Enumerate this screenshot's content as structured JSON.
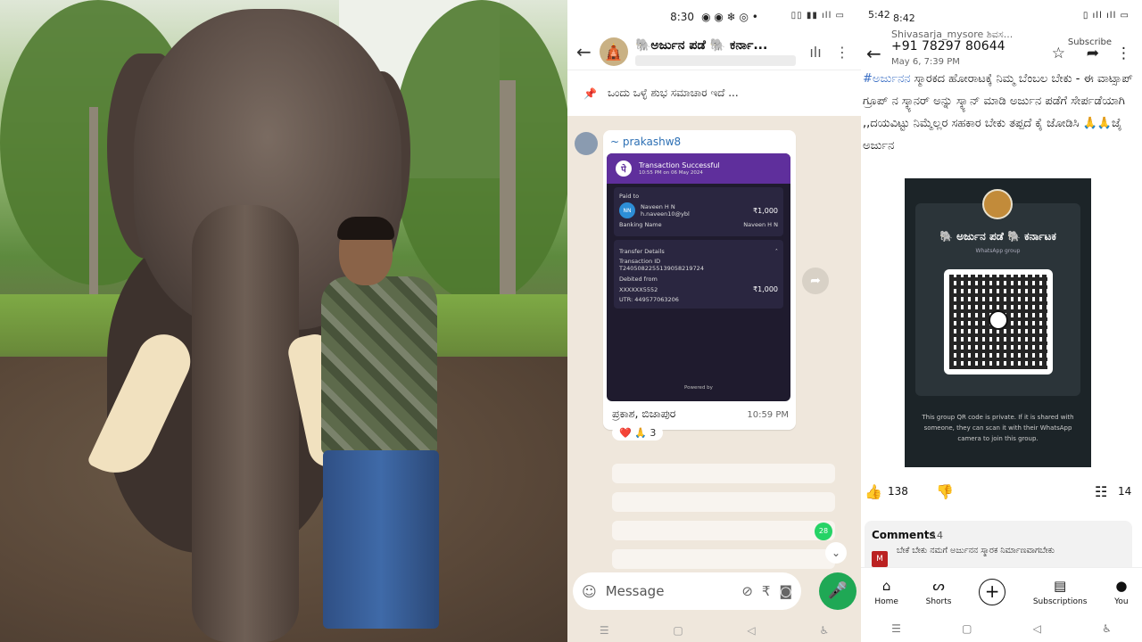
{
  "photo": {
    "description_icon": "elephant-photo"
  },
  "whatsapp": {
    "status_time": "8:30",
    "status_icons": "◉ ◉ ❄ ◎ •",
    "status_right": "▯▯ ▮▮ ıll ▭",
    "group_title": "🐘ಅರ್ಜುನ ಪಡೆ 🐘 ಕರ್ನಾ...",
    "pinned_text": "ಒಂದು ಒಳ್ಳೆ ಶುಭ ಸಮಾಚಾರ ಇದೆ ...",
    "sender": "~ prakashw8",
    "receipt": {
      "title": "Transaction Successful",
      "time": "10:55 PM on 06 May 2024",
      "paid_to_label": "Paid to",
      "initials": "NN",
      "payee": "Naveen H N",
      "upi": "h.naveen10@ybl",
      "amount": "₹1,000",
      "banking_label": "Banking Name",
      "banking_name": "Naveen H N",
      "transfer_label": "Transfer Details",
      "txn_label": "Transaction ID",
      "txn_id": "T2405082255139058219724",
      "debited_label": "Debited from",
      "account": "XXXXXX5552",
      "debit_amount": "₹1,000",
      "utr": "UTR: 449577063206",
      "powered": "Powered by"
    },
    "caption": "ಪ್ರಕಾಶ, ಬಿಜಾಪುರ",
    "time": "10:59 PM",
    "reactions": "❤️ 🙏 3",
    "unread_count": "28",
    "composer_placeholder": "Message"
  },
  "youtube": {
    "status_time": "5:42",
    "status_time2": "8:42",
    "status_right": "▯ ıll ıll ▭",
    "channel": "Shivasarja_mysore ಶಿವಸ...",
    "phone": "+91 78297 80644",
    "date": "May 6, 7:39 PM",
    "subscribe": "Subscribe",
    "post_hash": "#ಅರ್ಜುನನ",
    "post_text": " ಸ್ಮಾರಕದ ಹೋರಾಟಕ್ಕೆ ನಿಮ್ಮ ಬೆಂಬಲ ಬೇಕು - ಈ ವಾಟ್ಸಾಪ್ ಗ್ರೂಪ್ ನ ಸ್ಕ್ಯಾನರ್ ಅನ್ನು ಸ್ಕ್ಯಾನ್ ಮಾಡಿ ಅರ್ಜುನ ಪಡೆಗೆ ಸೇರ್ಪಡೆಯಾಗಿ ,,ದಯವಿಟ್ಟು ನಿಮ್ಮೆಲ್ಲರ ಸಹಕಾರ ಬೇಕು ತಪ್ಪದೆ ಕೈ ಜೋಡಿಸಿ 🙏🙏ಜೈ ಅರ್ಜುನ",
    "qr_group_name": "🐘 ಅರ್ಜುನ ಪಡೆ 🐘 ಕರ್ನಾಟಕ",
    "qr_group_sub": "WhatsApp group",
    "qr_note": "This group QR code is private. If it is shared with someone, they can scan it with their WhatsApp camera to join this group.",
    "likes": "138",
    "comments_count": "14",
    "comments_label": "Comments",
    "comments_count2": "14",
    "comment_text": "ಬೇಕೆ ಬೇಕು ನಮಗೆ ಅರ್ಜುನನ ಸ್ಮಾರಕ ನಿರ್ಮಾಣವಾಗಬೇಕು",
    "nav": {
      "home": "Home",
      "shorts": "Shorts",
      "subscriptions": "Subscriptions",
      "you": "You"
    }
  }
}
